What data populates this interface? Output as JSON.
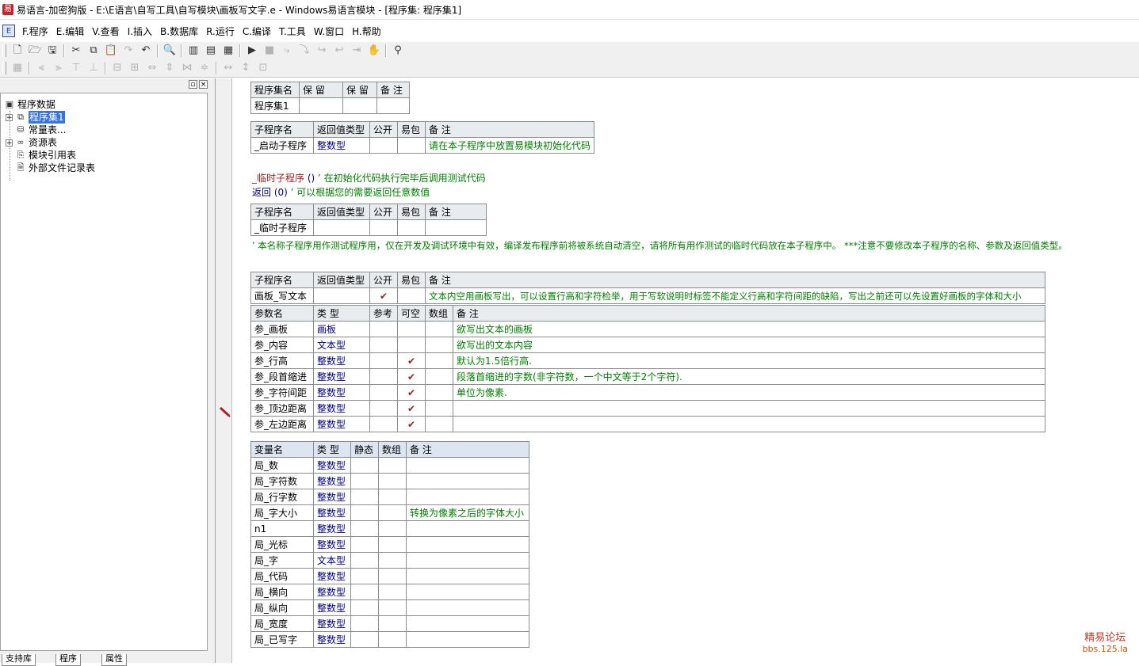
{
  "window": {
    "title": "易语言-加密狗版 - E:\\E语言\\自写工具\\自写模块\\画板写文字.e - Windows易语言模块 - [程序集: 程序集1]"
  },
  "menu": [
    "F.程序",
    "E.编辑",
    "V.查看",
    "I.插入",
    "B.数据库",
    "R.运行",
    "C.编译",
    "T.工具",
    "W.窗口",
    "H.帮助"
  ],
  "tree": {
    "root": "程序数据",
    "items": [
      "程序集1",
      "常量表...",
      "资源表",
      "模块引用表",
      "外部文件记录表"
    ]
  },
  "bottom_tabs": [
    "支持库",
    "程序",
    "属性"
  ],
  "assembly_table": {
    "headers": [
      "程序集名",
      "保 留",
      "保 留",
      "备 注"
    ],
    "row": [
      "程序集1",
      "",
      "",
      ""
    ]
  },
  "sub1_table": {
    "headers": [
      "子程序名",
      "返回值类型",
      "公开",
      "易包",
      "备 注"
    ],
    "row": [
      "_启动子程序",
      "整数型",
      "",
      "",
      "请在本子程序中放置易模块初始化代码"
    ]
  },
  "code_lines": {
    "line1_name": "_临时子程序",
    "line1_paren": " () ",
    "line1_comment": "’ 在初始化代码执行完毕后调用测试代码",
    "line2_kw": "返回",
    "line2_arg": " (0) ",
    "line2_comment": "’ 可以根据您的需要返回任意数值"
  },
  "sub2_table": {
    "headers": [
      "子程序名",
      "返回值类型",
      "公开",
      "易包",
      "备 注"
    ],
    "row": [
      "_临时子程序",
      "",
      "",
      "",
      ""
    ]
  },
  "temp_comment": "’ 本名称子程序用作测试程序用，仅在开发及调试环境中有效，编译发布程序前将被系统自动清空，请将所有用作测试的临时代码放在本子程序中。 ***注意不要修改本子程序的名称、参数及返回值类型。",
  "sub3_table": {
    "headers": [
      "子程序名",
      "返回值类型",
      "公开",
      "易包",
      "备 注"
    ],
    "row": [
      "画板_写文本",
      "",
      "✔",
      "",
      "文本内空用画板写出，可以设置行高和字符检举，用于写软说明时标签不能定义行高和字符间距的缺陷，写出之前还可以先设置好画板的字体和大小"
    ]
  },
  "params_table": {
    "headers": [
      "参数名",
      "类 型",
      "参考",
      "可空",
      "数组",
      "备 注"
    ],
    "rows": [
      [
        "参_画板",
        "画板",
        "",
        "",
        "",
        "欲写出文本的画板"
      ],
      [
        "参_内容",
        "文本型",
        "",
        "",
        "",
        "欲写出的文本内容"
      ],
      [
        "参_行高",
        "整数型",
        "",
        "✔",
        "",
        "默认为1.5倍行高."
      ],
      [
        "参_段首缩进",
        "整数型",
        "",
        "✔",
        "",
        "段落首缩进的字数(非字符数，一个中文等于2个字符)."
      ],
      [
        "参_字符间距",
        "整数型",
        "",
        "✔",
        "",
        "单位为像素."
      ],
      [
        "参_顶边距离",
        "整数型",
        "",
        "✔",
        "",
        ""
      ],
      [
        "参_左边距离",
        "整数型",
        "",
        "✔",
        "",
        ""
      ]
    ]
  },
  "vars_table": {
    "headers": [
      "变量名",
      "类 型",
      "静态",
      "数组",
      "备 注"
    ],
    "rows": [
      [
        "局_数",
        "整数型",
        "",
        "",
        ""
      ],
      [
        "局_字符数",
        "整数型",
        "",
        "",
        ""
      ],
      [
        "局_行字数",
        "整数型",
        "",
        "",
        ""
      ],
      [
        "局_字大小",
        "整数型",
        "",
        "",
        "转换为像素之后的字体大小"
      ],
      [
        "n1",
        "整数型",
        "",
        "",
        ""
      ],
      [
        "局_光标",
        "整数型",
        "",
        "",
        ""
      ],
      [
        "局_字",
        "文本型",
        "",
        "",
        ""
      ],
      [
        "局_代码",
        "整数型",
        "",
        "",
        ""
      ],
      [
        "局_横向",
        "整数型",
        "",
        "",
        ""
      ],
      [
        "局_纵向",
        "整数型",
        "",
        "",
        ""
      ],
      [
        "局_宽度",
        "整数型",
        "",
        "",
        ""
      ],
      [
        "局_已写字",
        "整数型",
        "",
        "",
        ""
      ]
    ]
  },
  "watermark": {
    "line1": "精易论坛",
    "line2": "bbs.125.la"
  }
}
